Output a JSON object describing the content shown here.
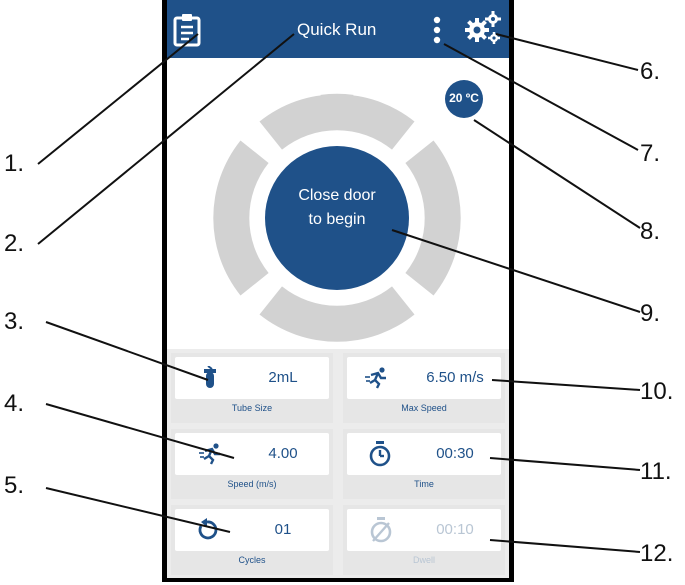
{
  "app": {
    "title": "Quick Run"
  },
  "temperature": {
    "label": "20 ºC"
  },
  "rotor": {
    "status_line1": "Close door",
    "status_line2": "to begin"
  },
  "tiles": [
    {
      "value": "2mL",
      "caption": "Tube Size",
      "icon": "tube-icon"
    },
    {
      "value": "6.50 m/s",
      "caption": "Max Speed",
      "icon": "runner-icon"
    },
    {
      "value": "4.00",
      "caption": "Speed (m/s)",
      "icon": "runner-icon"
    },
    {
      "value": "00:30",
      "caption": "Time",
      "icon": "timer-icon"
    },
    {
      "value": "01",
      "caption": "Cycles",
      "icon": "cycle-icon"
    },
    {
      "value": "00:10",
      "caption": "Dwell",
      "icon": "dwell-timer-icon",
      "disabled": true
    }
  ],
  "callouts": [
    "1.",
    "2.",
    "3.",
    "4.",
    "5.",
    "6.",
    "7.",
    "8.",
    "9.",
    "10.",
    "11.",
    "12."
  ],
  "colors": {
    "primary": "#1f5189",
    "rotor_gray": "#d2d2d2",
    "tile_bg": "#e6e6e6"
  }
}
